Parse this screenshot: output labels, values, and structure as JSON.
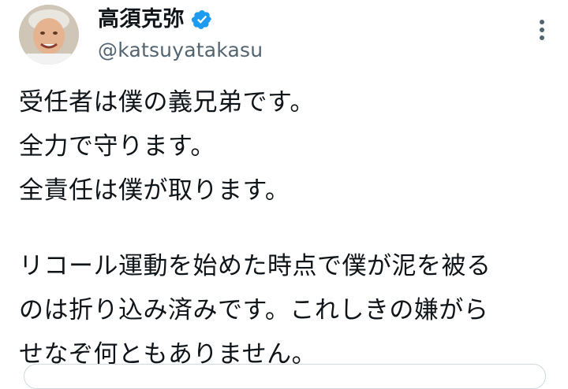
{
  "author": {
    "display_name": "高須克弥",
    "handle": "@katsuyatakasu",
    "verified": true,
    "verified_color": "#1d9bf0"
  },
  "tweet": {
    "lines": [
      "受任者は僕の義兄弟です。",
      "全力で守ります。",
      "全責任は僕が取ります。",
      "",
      "リコール運動を始めた時点で僕が泥を被る",
      "のは折り込み済みです。これしきの嫌がら",
      "せなぞ何ともありません。"
    ]
  },
  "icons": {
    "more": "more-vertical-icon",
    "verified": "verified-badge-icon"
  },
  "colors": {
    "text_primary": "#0f1419",
    "text_secondary": "#536471",
    "border": "#cfd9de"
  }
}
